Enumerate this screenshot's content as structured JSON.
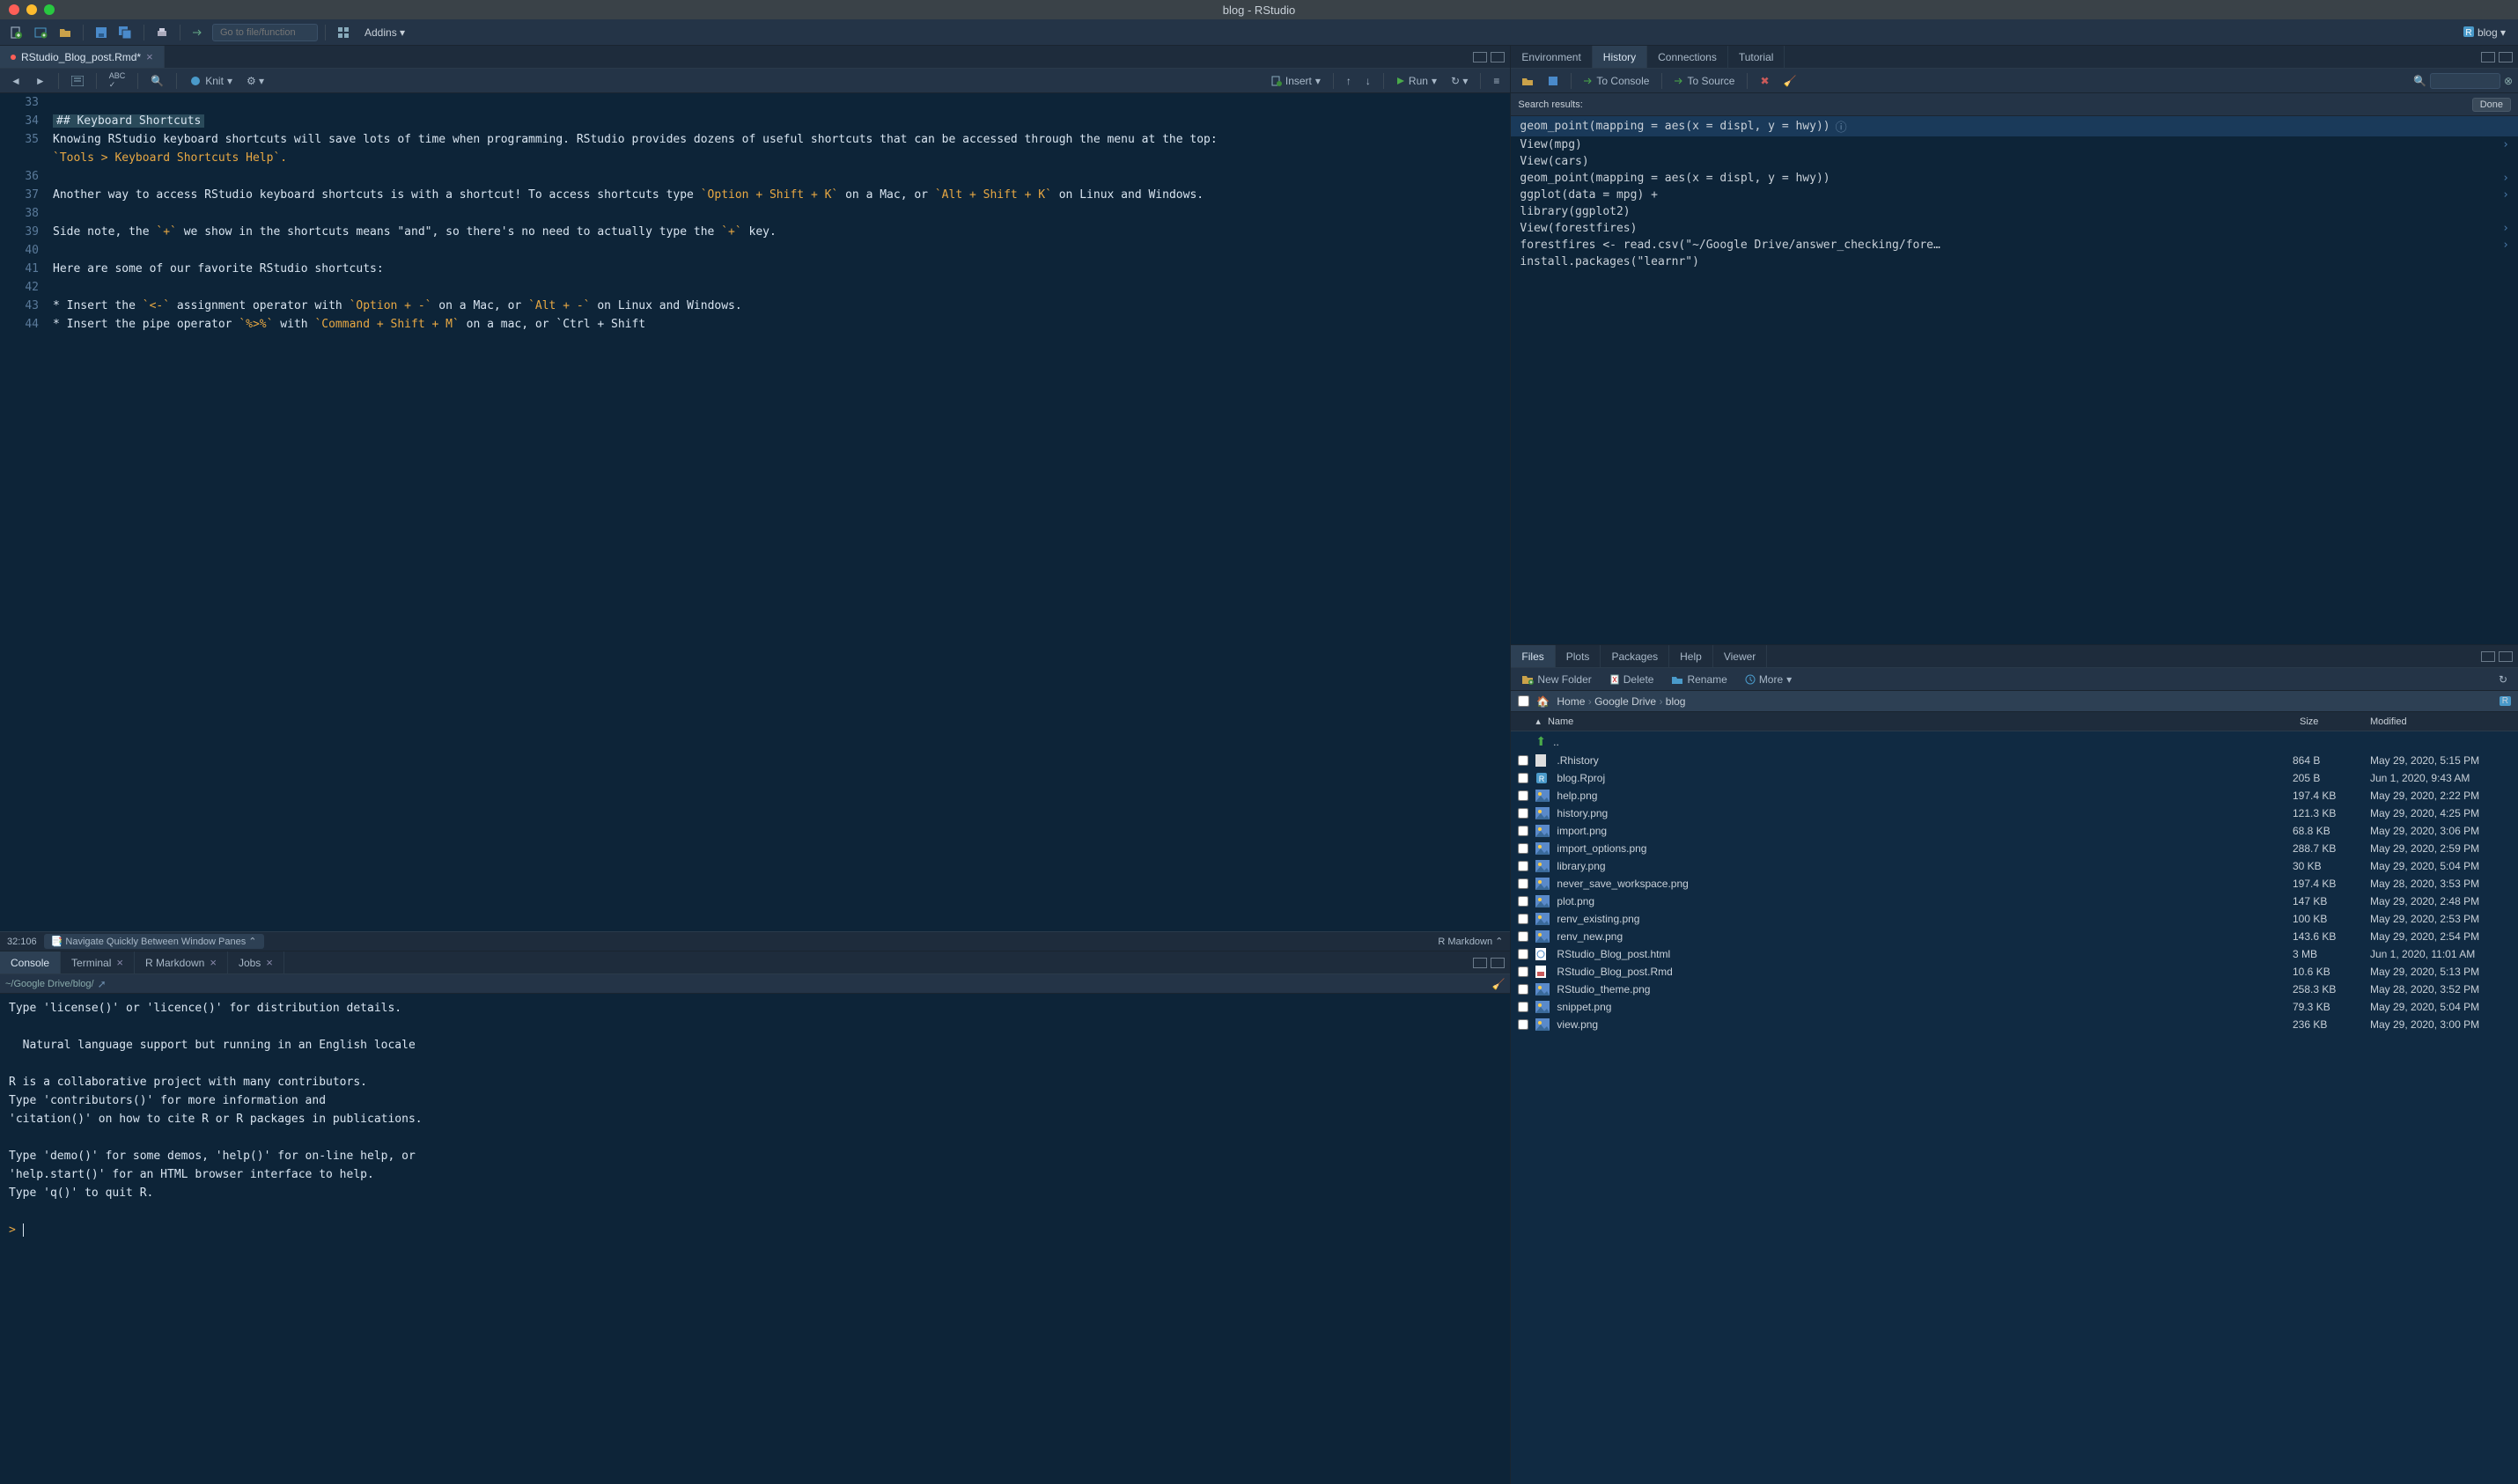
{
  "title": "blog - RStudio",
  "toolbar": {
    "goto_placeholder": "Go to file/function",
    "addins": "Addins",
    "project": "blog"
  },
  "source": {
    "tab_name": "RStudio_Blog_post.Rmd*",
    "knit": "Knit",
    "insert": "Insert",
    "run": "Run",
    "lines": [
      {
        "n": 33,
        "t": ""
      },
      {
        "n": 34,
        "t": "## Keyboard Shortcuts",
        "head": true
      },
      {
        "n": 35,
        "t": "Knowing RStudio keyboard shortcuts will save lots of time when programming. RStudio provides dozens of useful shortcuts that can be accessed through the menu at the top: "
      },
      {
        "n": "",
        "t": "`Tools > Keyboard Shortcuts Help`.",
        "code": true
      },
      {
        "n": 36,
        "t": ""
      },
      {
        "n": 37,
        "t": "Another way to access RStudio keyboard shortcuts is with a shortcut! To access shortcuts type `Option + Shift + K` on a Mac, or `Alt + Shift + K` on Linux and Windows.",
        "mix": true
      },
      {
        "n": 38,
        "t": ""
      },
      {
        "n": 39,
        "t": "Side note, the `+` we show in the shortcuts means \"and\", so there's no need to actually type the `+` key.",
        "mix": true
      },
      {
        "n": 40,
        "t": ""
      },
      {
        "n": 41,
        "t": "Here are some of our favorite RStudio shortcuts:"
      },
      {
        "n": 42,
        "t": ""
      },
      {
        "n": 43,
        "t": "* Insert the `<-` assignment operator with `Option + -` on a Mac, or `Alt + -` on Linux and Windows.",
        "mix": true
      },
      {
        "n": 44,
        "t": "* Insert the pipe operator `%>%` with `Command + Shift + M` on a mac, or `Ctrl + Shift",
        "mix": true
      }
    ],
    "cursor": "32:106",
    "nav_label": "Navigate Quickly Between Window Panes",
    "mode": "R Markdown"
  },
  "console": {
    "tabs": [
      "Console",
      "Terminal",
      "R Markdown",
      "Jobs"
    ],
    "active_tab": 0,
    "path": "~/Google Drive/blog/",
    "body": "Type 'license()' or 'licence()' for distribution details.\n\n  Natural language support but running in an English locale\n\nR is a collaborative project with many contributors.\nType 'contributors()' for more information and\n'citation()' on how to cite R or R packages in publications.\n\nType 'demo()' for some demos, 'help()' for on-line help, or\n'help.start()' for an HTML browser interface to help.\nType 'q()' to quit R.\n",
    "prompt": ">"
  },
  "env": {
    "tabs": [
      "Environment",
      "History",
      "Connections",
      "Tutorial"
    ],
    "active_tab": 1,
    "to_console": "To Console",
    "to_source": "To Source",
    "search_label": "Search results:",
    "done": "Done",
    "history": [
      {
        "t": "geom_point(mapping = aes(x = displ, y = hwy))",
        "sel": true,
        "info": true
      },
      {
        "t": "View(mpg)",
        "arr": true
      },
      {
        "t": "View(cars)"
      },
      {
        "t": "geom_point(mapping = aes(x = displ, y = hwy))",
        "arr": true
      },
      {
        "t": "ggplot(data = mpg) +",
        "arr": true
      },
      {
        "t": "library(ggplot2)"
      },
      {
        "t": "View(forestfires)",
        "arr": true
      },
      {
        "t": "forestfires <- read.csv(\"~/Google Drive/answer_checking/fore…",
        "arr": true
      },
      {
        "t": "install.packages(\"learnr\")"
      }
    ]
  },
  "files": {
    "tabs": [
      "Files",
      "Plots",
      "Packages",
      "Help",
      "Viewer"
    ],
    "active_tab": 0,
    "new_folder": "New Folder",
    "delete": "Delete",
    "rename": "Rename",
    "more": "More",
    "breadcrumb": [
      "Home",
      "Google Drive",
      "blog"
    ],
    "headers": {
      "name": "Name",
      "size": "Size",
      "mod": "Modified"
    },
    "up": "..",
    "rows": [
      {
        "name": ".Rhistory",
        "size": "864 B",
        "mod": "May 29, 2020, 5:15 PM",
        "icon": "file"
      },
      {
        "name": "blog.Rproj",
        "size": "205 B",
        "mod": "Jun 1, 2020, 9:43 AM",
        "icon": "rproj"
      },
      {
        "name": "help.png",
        "size": "197.4 KB",
        "mod": "May 29, 2020, 2:22 PM",
        "icon": "img"
      },
      {
        "name": "history.png",
        "size": "121.3 KB",
        "mod": "May 29, 2020, 4:25 PM",
        "icon": "img"
      },
      {
        "name": "import.png",
        "size": "68.8 KB",
        "mod": "May 29, 2020, 3:06 PM",
        "icon": "img"
      },
      {
        "name": "import_options.png",
        "size": "288.7 KB",
        "mod": "May 29, 2020, 2:59 PM",
        "icon": "img"
      },
      {
        "name": "library.png",
        "size": "30 KB",
        "mod": "May 29, 2020, 5:04 PM",
        "icon": "img"
      },
      {
        "name": "never_save_workspace.png",
        "size": "197.4 KB",
        "mod": "May 28, 2020, 3:53 PM",
        "icon": "img"
      },
      {
        "name": "plot.png",
        "size": "147 KB",
        "mod": "May 29, 2020, 2:48 PM",
        "icon": "img"
      },
      {
        "name": "renv_existing.png",
        "size": "100 KB",
        "mod": "May 29, 2020, 2:53 PM",
        "icon": "img"
      },
      {
        "name": "renv_new.png",
        "size": "143.6 KB",
        "mod": "May 29, 2020, 2:54 PM",
        "icon": "img"
      },
      {
        "name": "RStudio_Blog_post.html",
        "size": "3 MB",
        "mod": "Jun 1, 2020, 11:01 AM",
        "icon": "html"
      },
      {
        "name": "RStudio_Blog_post.Rmd",
        "size": "10.6 KB",
        "mod": "May 29, 2020, 5:13 PM",
        "icon": "rmd"
      },
      {
        "name": "RStudio_theme.png",
        "size": "258.3 KB",
        "mod": "May 28, 2020, 3:52 PM",
        "icon": "img"
      },
      {
        "name": "snippet.png",
        "size": "79.3 KB",
        "mod": "May 29, 2020, 5:04 PM",
        "icon": "img"
      },
      {
        "name": "view.png",
        "size": "236 KB",
        "mod": "May 29, 2020, 3:00 PM",
        "icon": "img"
      }
    ]
  }
}
